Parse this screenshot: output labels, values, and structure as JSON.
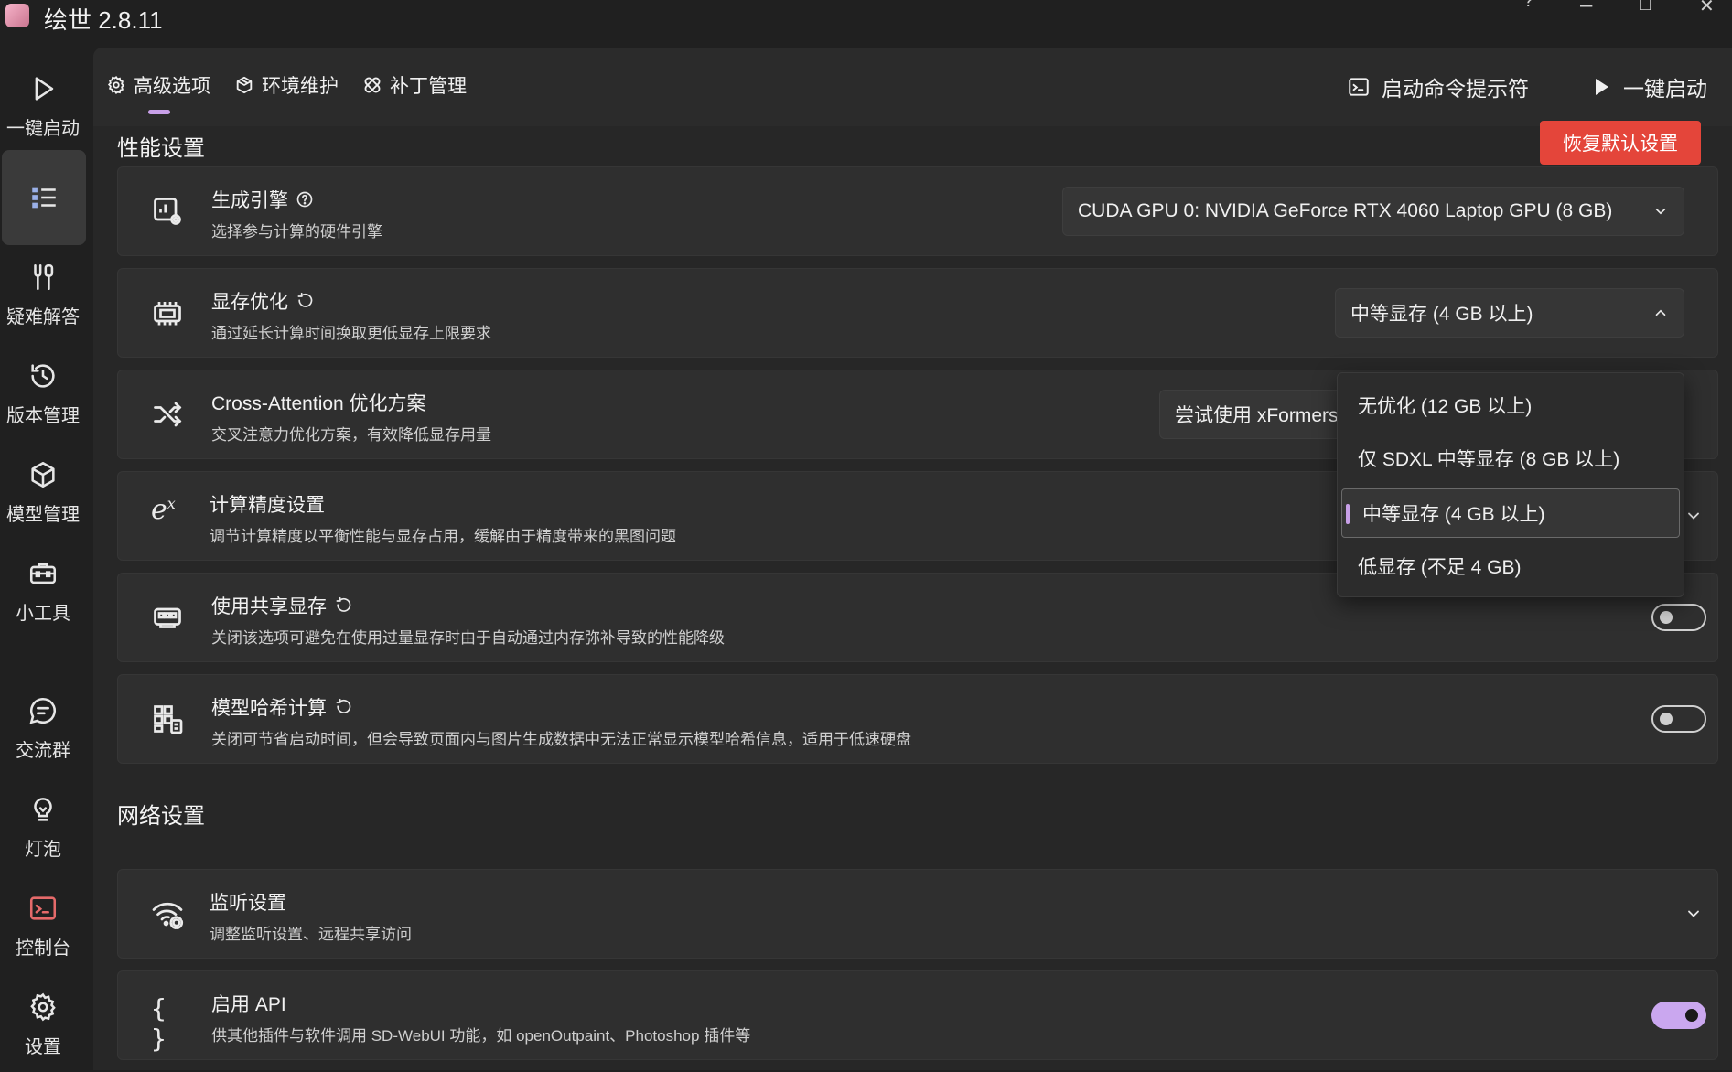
{
  "app": {
    "title": "绘世 2.8.11"
  },
  "window": {
    "help": "?",
    "minimize": "–",
    "maximize": "□",
    "close": "✕"
  },
  "sidebar": {
    "items": [
      {
        "label": "一键启动",
        "icon": "play-icon"
      },
      {
        "label": "",
        "icon": "list-icon",
        "selected": true
      },
      {
        "label": "疑难解答",
        "icon": "tools-icon"
      },
      {
        "label": "版本管理",
        "icon": "history-icon"
      },
      {
        "label": "模型管理",
        "icon": "cube-icon"
      },
      {
        "label": "小工具",
        "icon": "toolbox-icon"
      },
      {
        "label": "交流群",
        "icon": "chat-icon"
      },
      {
        "label": "灯泡",
        "icon": "bulb-icon"
      },
      {
        "label": "控制台",
        "icon": "console-icon"
      },
      {
        "label": "设置",
        "icon": "gear-icon"
      }
    ]
  },
  "tabs": [
    {
      "label": "高级选项",
      "icon": "gear-icon",
      "active": true
    },
    {
      "label": "环境维护",
      "icon": "package-icon"
    },
    {
      "label": "补丁管理",
      "icon": "bandage-icon"
    }
  ],
  "actions": {
    "terminal": "启动命令提示符",
    "launch": "一键启动"
  },
  "performance": {
    "title": "性能设置",
    "reset": "恢复默认设置",
    "engine": {
      "title": "生成引擎",
      "subtitle": "选择参与计算的硬件引擎",
      "value": "CUDA GPU 0: NVIDIA GeForce RTX 4060 Laptop GPU (8 GB)"
    },
    "vram": {
      "title": "显存优化",
      "subtitle": "通过延长计算时间换取更低显存上限要求",
      "value": "中等显存 (4 GB 以上)",
      "options": [
        "无优化 (12 GB 以上)",
        "仅 SDXL 中等显存 (8 GB 以上)",
        "中等显存 (4 GB 以上)",
        "低显存 (不足 4 GB)"
      ],
      "selected_index": 2
    },
    "cross_attention": {
      "title": "Cross-Attention 优化方案",
      "subtitle": "交叉注意力优化方案，有效降低显存用量",
      "value": "尝试使用 xFormers"
    },
    "precision": {
      "title": "计算精度设置",
      "subtitle": "调节计算精度以平衡性能与显存占用，缓解由于精度带来的黑图问题"
    },
    "shared_vram": {
      "title": "使用共享显存",
      "subtitle": "关闭该选项可避免在使用过量显存时由于自动通过内存弥补导致的性能降级",
      "on": false
    },
    "model_hash": {
      "title": "模型哈希计算",
      "subtitle": "关闭可节省启动时间，但会导致页面内与图片生成数据中无法正常显示模型哈希信息，适用于低速硬盘",
      "on": false
    }
  },
  "network": {
    "title": "网络设置",
    "listen": {
      "title": "监听设置",
      "subtitle": "调整监听设置、远程共享访问"
    },
    "api": {
      "title": "启用 API",
      "subtitle": "供其他插件与软件调用 SD-WebUI 功能，如 openOutpaint、Photoshop 插件等",
      "on": true
    }
  },
  "colors": {
    "accent": "#c8a0e8",
    "danger": "#e4453a",
    "background": "#202020"
  }
}
